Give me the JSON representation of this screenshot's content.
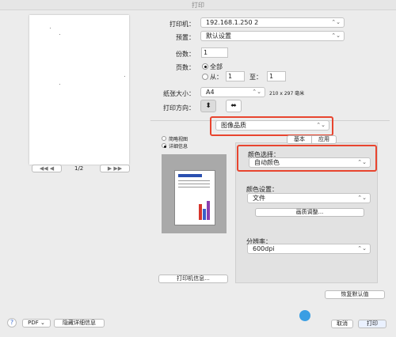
{
  "window": {
    "title": "打印"
  },
  "preview": {
    "page_label": "1/2",
    "prev_label": "◀◀  ◀",
    "next_label": "▶  ▶▶"
  },
  "printer": {
    "label": "打印机：",
    "value": "192.168.1.250 2"
  },
  "preset": {
    "label": "预置：",
    "value": "默认设置"
  },
  "copies": {
    "label": "份数：",
    "value": "1"
  },
  "pages": {
    "label": "页数：",
    "all": "全部",
    "from": "从：",
    "from_value": "1",
    "to": "至：",
    "to_value": "1"
  },
  "paper": {
    "label": "纸张大小：",
    "value": "A4",
    "dims": "210 x 297 毫米"
  },
  "orientation": {
    "label": "打印方向："
  },
  "section": {
    "value": "图像品质"
  },
  "view": {
    "simple": "简略视图",
    "detail": "详细信息"
  },
  "tabs": {
    "basic": "基本",
    "apply": "应用"
  },
  "color_select": {
    "label": "颜色选择：",
    "value": "自动颜色"
  },
  "color_setting": {
    "label": "颜色设置：",
    "value": "文件",
    "adjust_label": "画质调整..."
  },
  "resolution": {
    "label": "分辨率：",
    "value": "600dpi"
  },
  "printer_info_label": "打印机信息...",
  "restore_defaults_label": "恢复默认值",
  "footer": {
    "help": "?",
    "pdf_label": "PDF ⌄",
    "hide_details_label": "隐藏详细信息",
    "cancel_label": "取消",
    "print_label": "打印"
  },
  "colors": {
    "highlight": "#e8452f"
  }
}
